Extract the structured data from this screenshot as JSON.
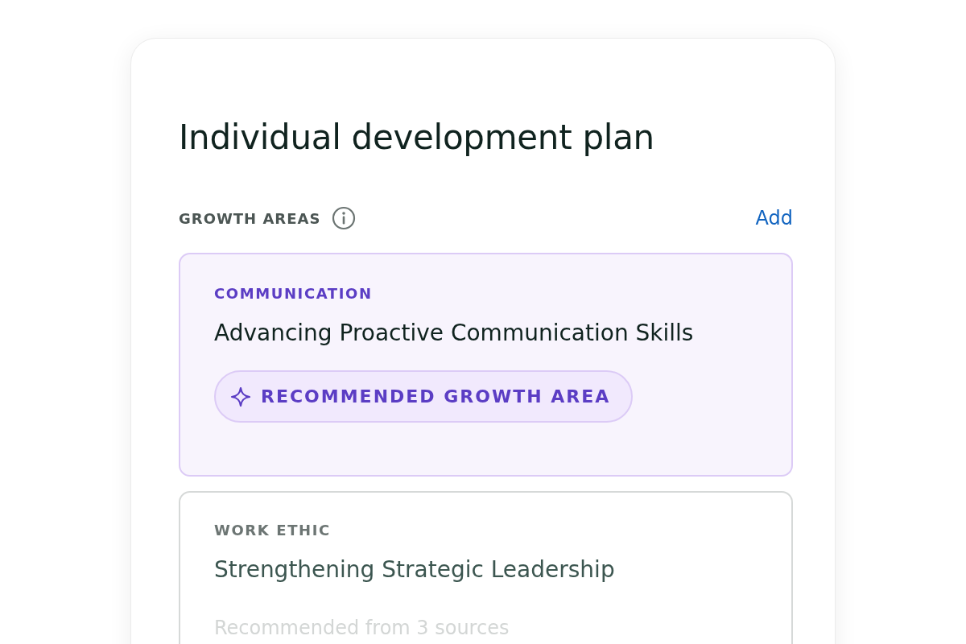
{
  "title": "Individual development plan",
  "section": {
    "heading": "GROWTH AREAS",
    "action": "Add"
  },
  "cards": [
    {
      "category": "COMMUNICATION",
      "title": "Advancing Proactive Communication Skills",
      "selected": true,
      "badge": "RECOMMENDED GROWTH AREA"
    },
    {
      "category": "WORK ETHIC",
      "title": "Strengthening Strategic Leadership",
      "selected": false,
      "note": "Recommended from 3 sources"
    }
  ]
}
